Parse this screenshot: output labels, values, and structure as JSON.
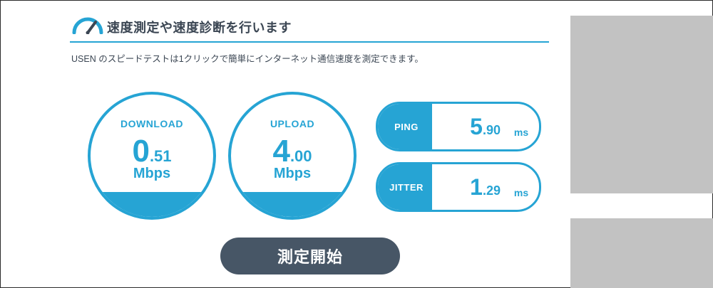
{
  "header": {
    "icon": "speedometer-icon",
    "title": "速度測定や速度診断を行います"
  },
  "description": "USEN のスピードテストは1クリックで簡単にインターネット通信速度を測定できます。",
  "download": {
    "label": "DOWNLOAD",
    "int": "0",
    "dec": ".51",
    "unit": "Mbps"
  },
  "upload": {
    "label": "UPLOAD",
    "int": "4",
    "dec": ".00",
    "unit": "Mbps"
  },
  "ping": {
    "label": "PING",
    "int": "5",
    "dec": ".90",
    "unit": "ms"
  },
  "jitter": {
    "label": "JITTER",
    "int": "1",
    "dec": ".29",
    "unit": "ms"
  },
  "start_button": {
    "label": "測定開始"
  },
  "colors": {
    "accent": "#26a4d4",
    "button": "#475666",
    "text": "#3b4653",
    "ad_placeholder": "#c2c2c2"
  }
}
